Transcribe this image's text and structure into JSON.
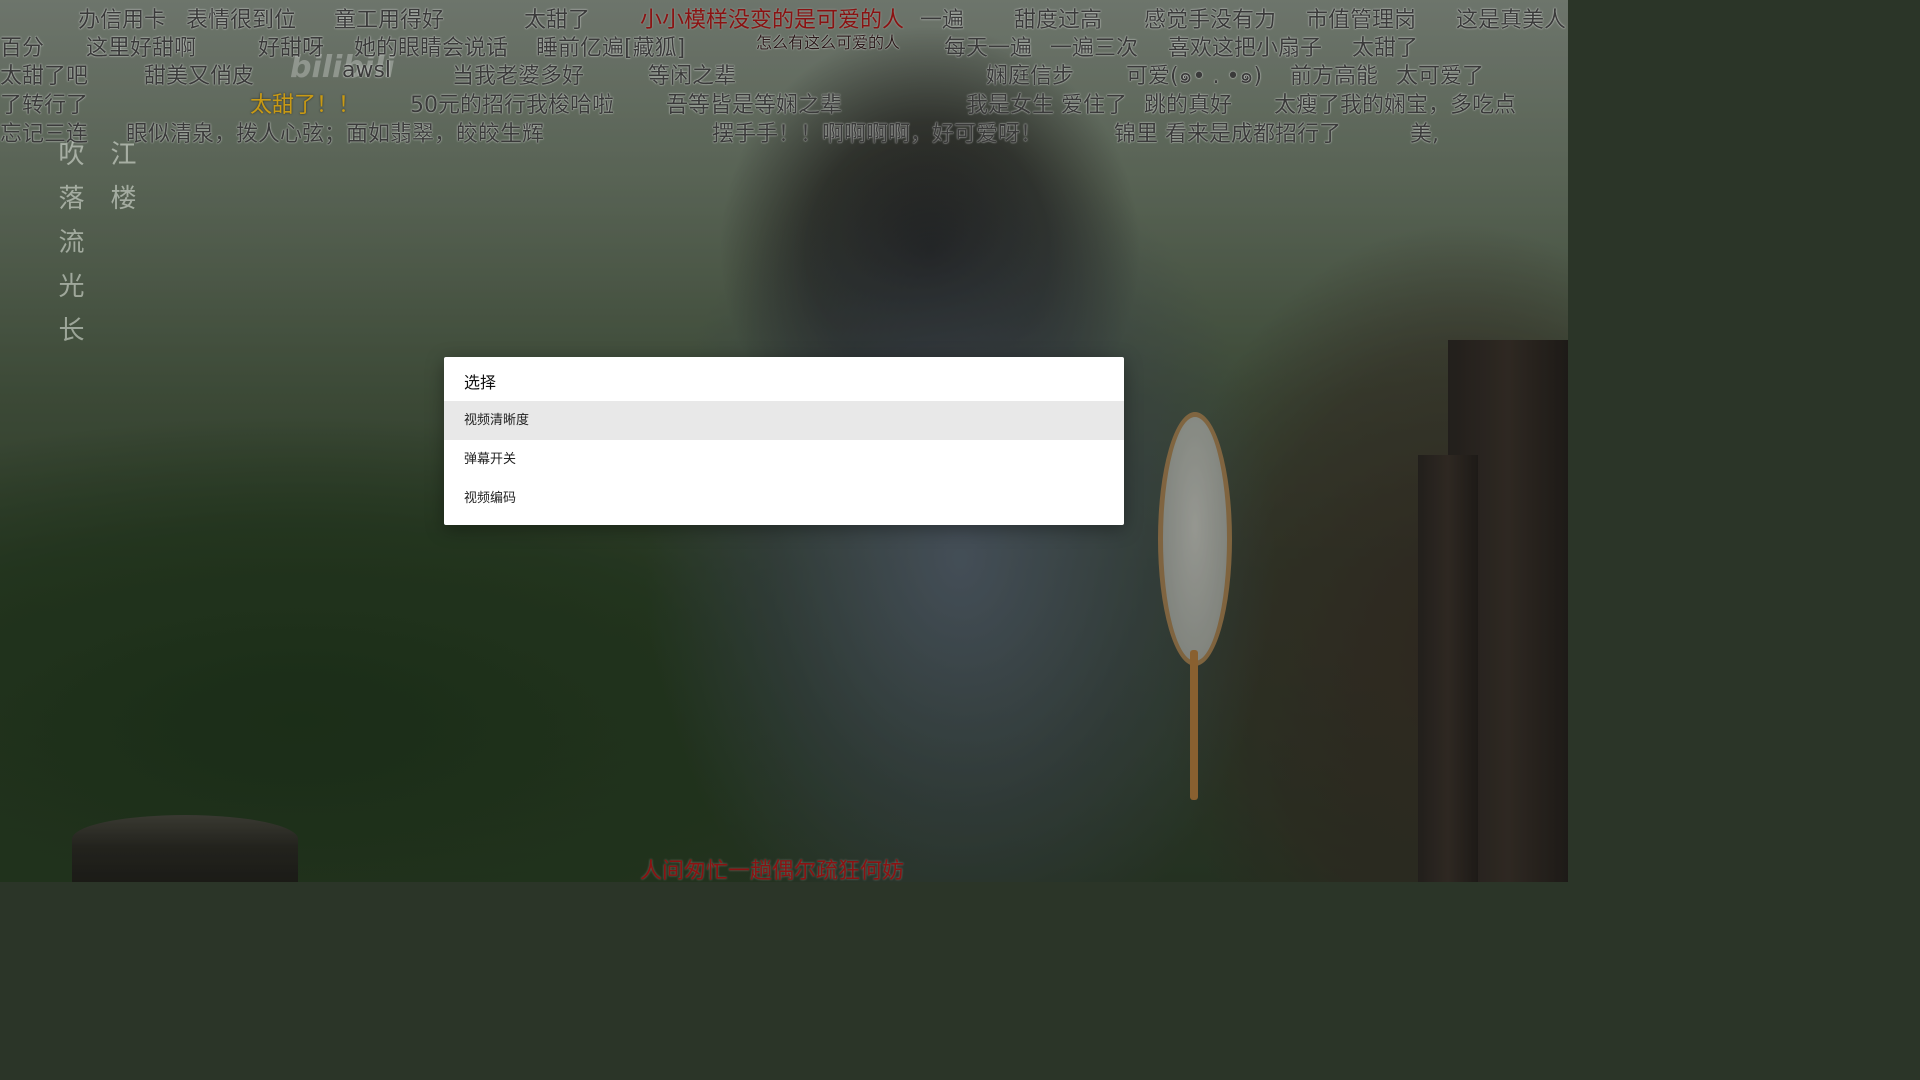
{
  "dialog": {
    "title": "选择",
    "items": [
      {
        "label": "视频清晰度",
        "selected": true
      },
      {
        "label": "弹幕开关",
        "selected": false
      },
      {
        "label": "视频编码",
        "selected": false
      }
    ]
  },
  "logo": {
    "text": "bilibili"
  },
  "poem": {
    "col1": "吹落流光长",
    "col2": "江楼"
  },
  "danmaku": {
    "row1": [
      "办信用卡",
      "表情很到位",
      "童工用得好",
      "太甜了",
      "小小模样没变的是可爱的人",
      "一遍",
      "甜度过高",
      "感觉手没有力",
      "市值管理岗",
      "这是真美人"
    ],
    "row2": [
      "百分",
      "这里好甜啊",
      "好甜呀",
      "她的眼睛会说话",
      "睡前亿遍[藏狐]",
      "怎么有这么可爱的人",
      "每天一遍",
      "一遍三次",
      "喜欢这把小扇子",
      "太甜了"
    ],
    "row3": [
      "太甜了吧",
      "甜美又俏皮",
      "awsl",
      "当我老婆多好",
      "等闲之辈",
      "娴庭信步",
      "可爱(๑• . •๑)",
      "前方高能",
      "太可爱了"
    ],
    "row4": [
      "了转行了",
      "太甜了！！",
      "50元的招行我梭哈啦",
      "吾等皆是等娴之辈",
      "我是女生 爱住了",
      "跳的真好",
      "太瘦了我的娴宝，多吃点"
    ],
    "row5": [
      "忘记三连",
      "眼似清泉，拨人心弦；面如翡翠，皎皎生辉",
      "摆手手！！啊啊啊啊，好可爱呀！",
      "锦里 看来是成都招行了",
      "美,"
    ],
    "bottom": "人间匆忙一趟偶尔疏狂何妨"
  },
  "colors": {
    "danmaku_default": "#3a3a3a",
    "danmaku_yellow": "#c99a14",
    "danmaku_red": "#8a1212",
    "dialog_bg": "#ffffff",
    "selected_bg": "#e8e8e8"
  }
}
